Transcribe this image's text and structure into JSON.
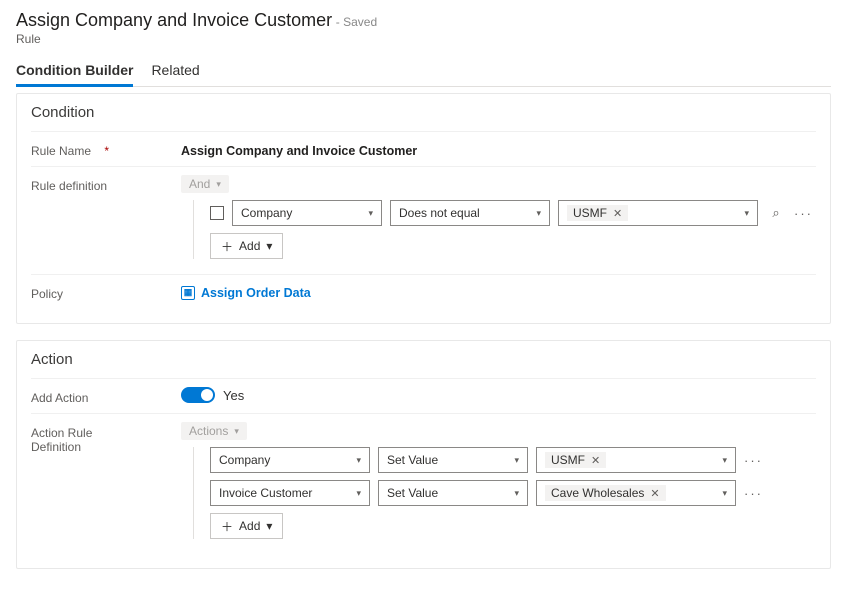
{
  "header": {
    "title": "Assign Company and Invoice Customer",
    "savedSuffix": "- Saved",
    "subtitle": "Rule"
  },
  "tabs": {
    "active": "Condition Builder",
    "other": "Related"
  },
  "condition": {
    "sectionTitle": "Condition",
    "ruleNameLabel": "Rule Name",
    "ruleNameValue": "Assign Company and Invoice Customer",
    "ruleDefLabel": "Rule definition",
    "groupOp": "And",
    "row": {
      "field": "Company",
      "operator": "Does not equal",
      "value": "USMF"
    },
    "addLabel": "Add",
    "policyLabel": "Policy",
    "policyLink": "Assign Order Data"
  },
  "action": {
    "sectionTitle": "Action",
    "addActionLabel": "Add Action",
    "addActionValue": "Yes",
    "ruleDefLabel1": "Action Rule",
    "ruleDefLabel2": "Definition",
    "groupOp": "Actions",
    "rows": [
      {
        "field": "Company",
        "operator": "Set Value",
        "value": "USMF"
      },
      {
        "field": "Invoice Customer",
        "operator": "Set Value",
        "value": "Cave Wholesales"
      }
    ],
    "addLabel": "Add"
  }
}
